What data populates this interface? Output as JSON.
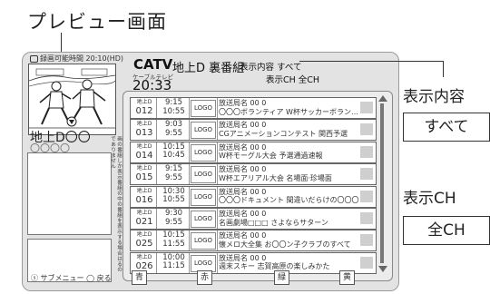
{
  "annotation": {
    "title": "プレビュー画面"
  },
  "status": {
    "recordable": "録画可能時間 20:10(HD)"
  },
  "left_panel": {
    "channel_name": "地上D〇〇",
    "channel_num": "〇〇〇〇",
    "vertical_note": "画の番組しか表示番組の中の番組を表示する場合はるのでありません"
  },
  "header": {
    "network": "CATV",
    "category": "地上D 裏番組",
    "display_mode": "表示内容 すべて",
    "display_sub": "表示CH 全CH",
    "small_label": "ケーブルテレビ",
    "time": "20:33"
  },
  "rows": [
    {
      "label": "地上D",
      "num": "012",
      "start": "9:15",
      "end": "10:55",
      "logo": "LOGO",
      "line1": "放送局名 00 0",
      "line2": "〇〇〇ボランティア W杯サッカーボラン…"
    },
    {
      "label": "地上D",
      "num": "013",
      "start": "9:03",
      "end": "9:55",
      "logo": "LOGO",
      "line1": "放送局名 00 0",
      "line2": "CGアニメーションコンテスト 関西予選"
    },
    {
      "label": "地上D",
      "num": "014",
      "start": "10:15",
      "end": "10:45",
      "logo": "LOGO",
      "line1": "放送局名 00 0",
      "line2": "W杯モーグル大会 予選通過速報"
    },
    {
      "label": "地上D",
      "num": "015",
      "start": "9:15",
      "end": "9:55",
      "logo": "LOGO",
      "line1": "放送局名 00 0",
      "line2": "W杯エアリアル大会 名場面·珍場面"
    },
    {
      "label": "地上D",
      "num": "016",
      "start": "10:30",
      "end": "10:55",
      "logo": "LOGO",
      "line1": "放送局名 00 0",
      "line2": "〇〇〇ドキュメント 間違いだらけの〇〇〇"
    },
    {
      "label": "地上D",
      "num": "021",
      "start": "9:30",
      "end": "9:55",
      "logo": "LOGO",
      "line1": "放送局名 00 0",
      "line2": "名画劇場□□□ さよならサターン"
    },
    {
      "label": "地上D",
      "num": "025",
      "start": "10:15",
      "end": "11:55",
      "logo": "LOGO",
      "line1": "放送局名 00 0",
      "line2": "懐メロ大全集 お〇〇ン子クラブのすべて"
    },
    {
      "label": "地上D",
      "num": "026",
      "start": "10:00",
      "end": "11:15",
      "logo": "LOGO",
      "line1": "放送局名 00 0",
      "line2": "週末スキー 志賀高原の楽しみかた"
    }
  ],
  "footer": {
    "submenu_text": "ⓢ サブメニュー ◯ 戻る",
    "buttons": [
      {
        "label": "青"
      },
      {
        "label": "赤"
      },
      {
        "label": "緑"
      },
      {
        "label": "黄"
      }
    ]
  },
  "callouts": {
    "display_content_label": "表示内容",
    "display_content_value": "すべて",
    "display_ch_label": "表示CH",
    "display_ch_value": "全CH"
  }
}
